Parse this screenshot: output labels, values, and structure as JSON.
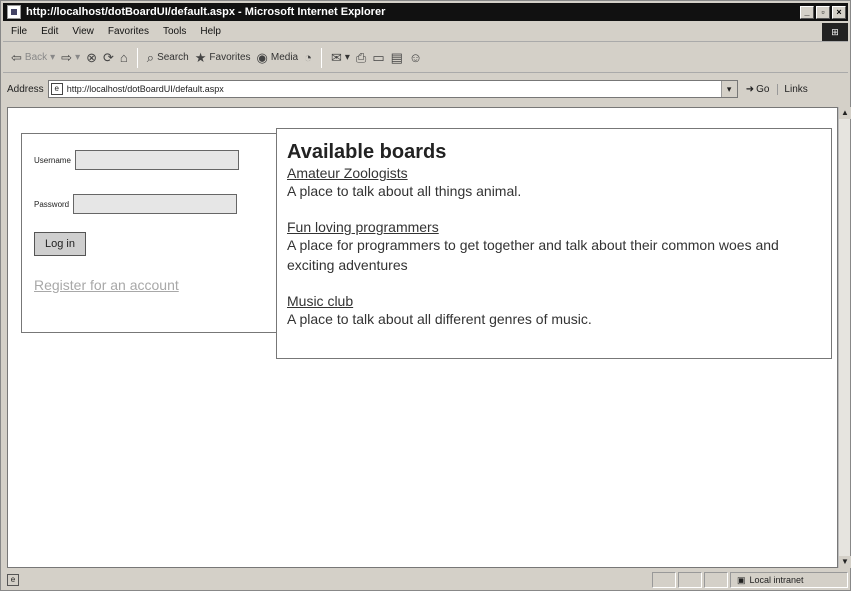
{
  "window": {
    "title": "http://localhost/dotBoardUI/default.aspx - Microsoft Internet Explorer",
    "controls": [
      "_",
      "▫",
      "×"
    ]
  },
  "menubar": {
    "items": [
      "File",
      "Edit",
      "View",
      "Favorites",
      "Tools",
      "Help"
    ]
  },
  "toolbar": {
    "back": "Back",
    "search": "Search",
    "favorites": "Favorites",
    "media": "Media"
  },
  "address": {
    "label": "Address",
    "url": "http://localhost/dotBoardUI/default.aspx",
    "go": "Go",
    "links": "Links"
  },
  "login": {
    "username_label": "Username",
    "password_label": "Password",
    "username_value": "",
    "password_value": "",
    "login_button": "Log in",
    "register_link": "Register for an account"
  },
  "boards": {
    "title": "Available boards",
    "items": [
      {
        "name": "Amateur Zoologists",
        "description": "A place to talk about all things animal."
      },
      {
        "name": "Fun loving programmers",
        "description": "A place for programmers to get together and talk about their common woes and exciting adventures"
      },
      {
        "name": "Music club",
        "description": "A place to talk about all different genres of music."
      }
    ]
  },
  "status": {
    "zone": "Local intranet"
  }
}
